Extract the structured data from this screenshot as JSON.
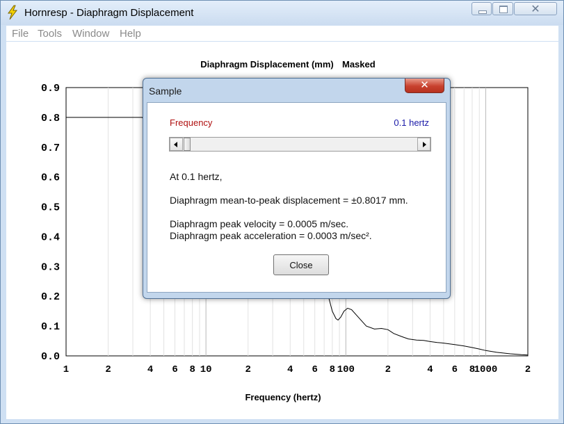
{
  "window": {
    "title": "Hornresp - Diaphragm Displacement"
  },
  "icons": {
    "app": "lightning-bolt-icon",
    "minimize": "minimize-icon",
    "maximize": "maximize-icon",
    "close": "close-icon"
  },
  "menu": {
    "items": [
      {
        "label": "File"
      },
      {
        "label": "Tools"
      },
      {
        "label": "Window"
      },
      {
        "label": "Help"
      }
    ]
  },
  "chart_data": {
    "type": "line",
    "title": "Diaphragm Displacement (mm)",
    "title_suffix": "Masked",
    "xlabel": "Frequency (hertz)",
    "ylabel": "",
    "x_scale": "log",
    "xlim": [
      1,
      2000
    ],
    "ylim": [
      0,
      0.9
    ],
    "grid": true,
    "y_ticks": [
      "0.0",
      "0.1",
      "0.2",
      "0.3",
      "0.4",
      "0.5",
      "0.6",
      "0.7",
      "0.8",
      "0.9"
    ],
    "x_tick_labels": [
      {
        "value": 1,
        "label": "1"
      },
      {
        "value": 2,
        "label": "2"
      },
      {
        "value": 4,
        "label": "4"
      },
      {
        "value": 6,
        "label": "6"
      },
      {
        "value": 8,
        "label": "8"
      },
      {
        "value": 10,
        "label": "10"
      },
      {
        "value": 20,
        "label": "2"
      },
      {
        "value": 40,
        "label": "4"
      },
      {
        "value": 60,
        "label": "6"
      },
      {
        "value": 80,
        "label": "8"
      },
      {
        "value": 100,
        "label": "100"
      },
      {
        "value": 200,
        "label": "2"
      },
      {
        "value": 400,
        "label": "4"
      },
      {
        "value": 600,
        "label": "6"
      },
      {
        "value": 800,
        "label": "8"
      },
      {
        "value": 1000,
        "label": "1000"
      },
      {
        "value": 2000,
        "label": "2"
      }
    ],
    "series": [
      {
        "color": "#000000",
        "x": [
          1,
          3.5,
          75,
          80,
          85,
          88,
          92,
          97,
          103,
          110,
          120,
          140,
          160,
          180,
          200,
          220,
          250,
          280,
          320,
          360,
          400,
          450,
          500,
          600,
          700,
          800,
          900,
          1000,
          1200,
          1500,
          1800,
          2000
        ],
        "y": [
          0.8,
          0.8,
          0.2,
          0.15,
          0.125,
          0.12,
          0.13,
          0.15,
          0.16,
          0.155,
          0.135,
          0.1,
          0.09,
          0.092,
          0.088,
          0.075,
          0.065,
          0.057,
          0.053,
          0.052,
          0.048,
          0.045,
          0.043,
          0.038,
          0.033,
          0.028,
          0.023,
          0.018,
          0.012,
          0.007,
          0.004,
          0.003
        ]
      }
    ]
  },
  "dialog": {
    "title": "Sample",
    "frequency_label": "Frequency",
    "frequency_value": "0.1 hertz",
    "slider_fraction": 0.0,
    "at_line": "At 0.1 hertz,",
    "displacement_line": "Diaphragm mean-to-peak displacement = ±0.8017 mm.",
    "velocity_line": "Diaphragm peak velocity = 0.0005 m/sec.",
    "acceleration_line": "Diaphragm peak acceleration = 0.0003 m/sec².",
    "close_label": "Close",
    "colors": {
      "frequency_label": "#b01010",
      "frequency_value": "#1a1aa8"
    }
  }
}
